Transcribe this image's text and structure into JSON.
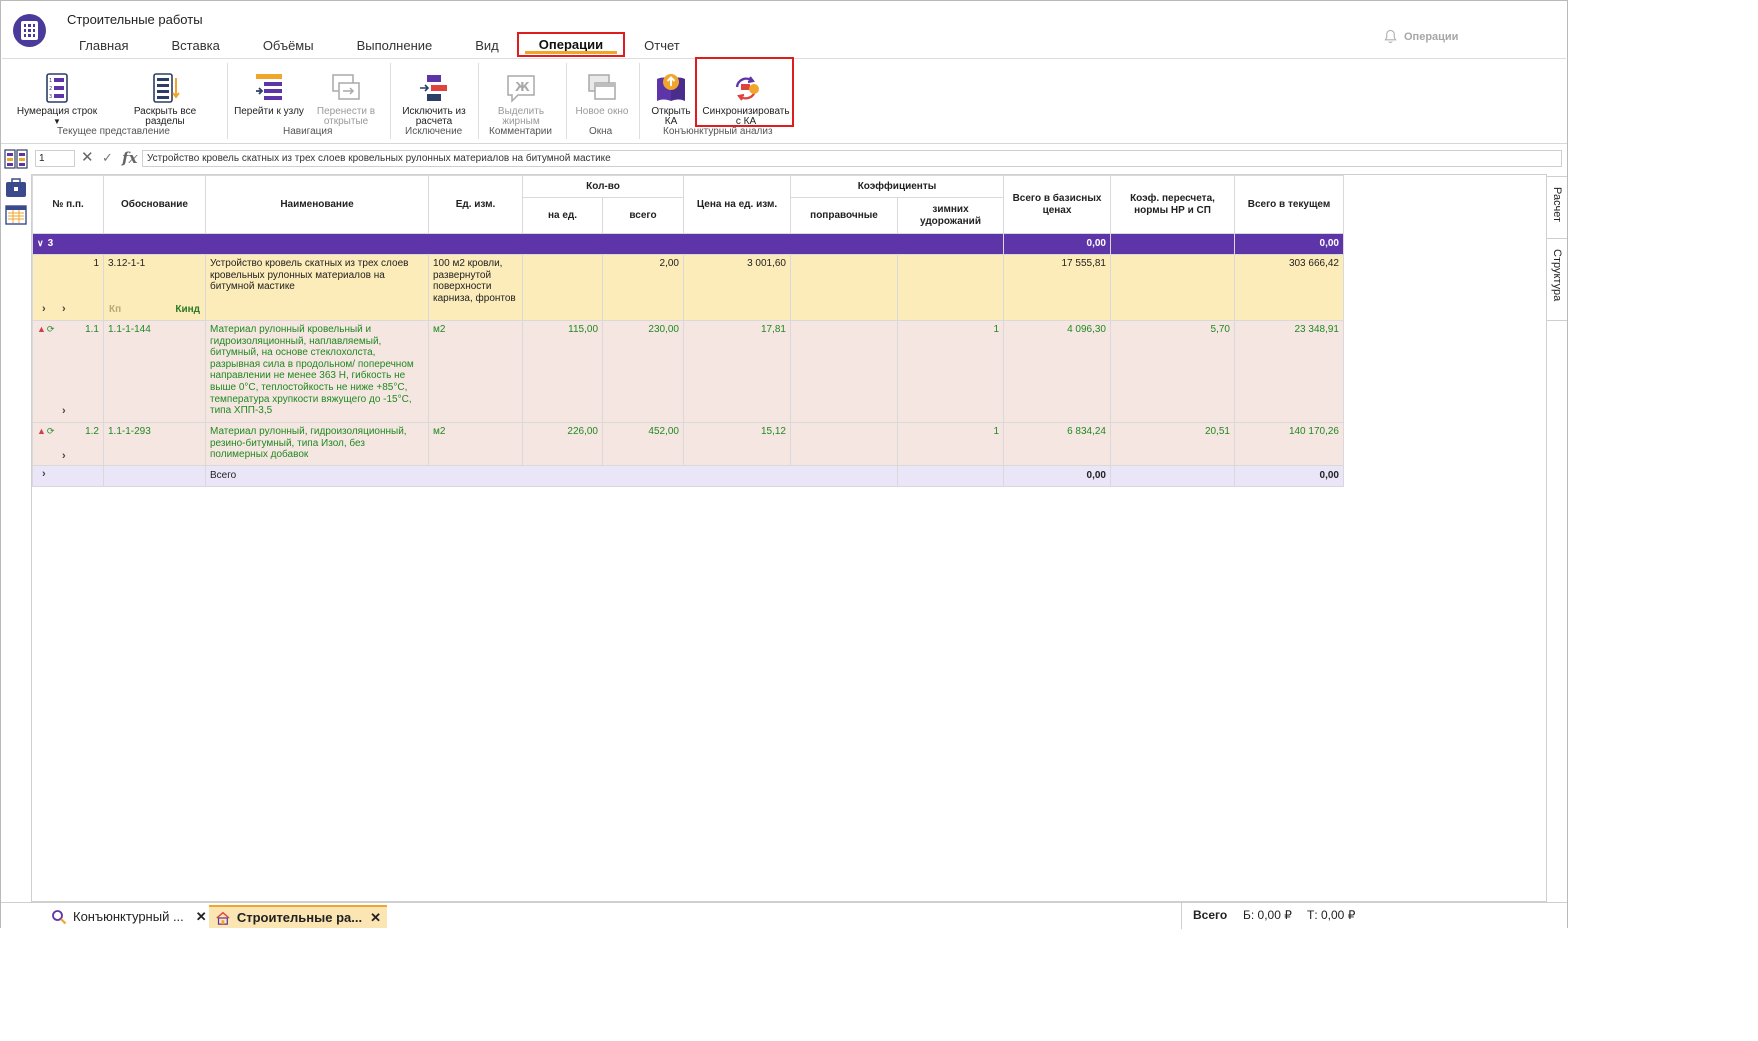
{
  "app": {
    "title": "Строительные работы",
    "notification_label": "Операции"
  },
  "menu": {
    "tabs": [
      {
        "label": "Главная"
      },
      {
        "label": "Вставка"
      },
      {
        "label": "Объёмы"
      },
      {
        "label": "Выполнение"
      },
      {
        "label": "Вид"
      },
      {
        "label": "Операции",
        "active": true
      },
      {
        "label": "Отчет"
      }
    ]
  },
  "ribbon": {
    "line_numbering": "Нумерация строк",
    "expand_sections": "Раскрыть все разделы",
    "group_view": "Текущее представление",
    "goto_node": "Перейти к узлу",
    "move_to_open": "Перенести в открытые",
    "group_nav": "Навигация",
    "exclude_calc": "Исключить из расчета",
    "group_exclusion": "Исключение",
    "bold": "Выделить жирным",
    "group_comments": "Комментарии",
    "new_window": "Новое окно",
    "group_windows": "Окна",
    "open_ka": "Открыть КА",
    "sync_ka": "Синхронизировать с КА",
    "group_market": "Конъюнктурный анализ",
    "accent_color": "#e01d1d"
  },
  "formula_bar": {
    "cell": "1",
    "value": "Устройство кровель скатных из трех слоев кровельных рулонных материалов на битумной мастике"
  },
  "table": {
    "headers": {
      "num": "№ п.п.",
      "basis": "Обоснование",
      "name": "Наименование",
      "unit": "Ед. изм.",
      "qty": "Кол-во",
      "qty_per_unit": "на ед.",
      "qty_total": "всего",
      "price": "Цена на ед. изм.",
      "coefs": "Коэффициенты",
      "coef_corr": "поправочные",
      "coef_winter": "зимних удорожаний",
      "total_base": "Всего в базисных ценах",
      "recalc": "Коэф. пересчета, нормы НР и СП",
      "total_current": "Всего в текущем"
    },
    "section": {
      "label": "3",
      "total_base": "0,00",
      "total_current": "0,00"
    },
    "main_row": {
      "num": "1",
      "basis": "3.12-1-1",
      "name": "Устройство кровель скатных из трех слоев кровельных рулонных материалов на битумной мастике",
      "unit": "100 м2 кровли, развернутой поверхности карниза, фронтов",
      "qty_total": "2,00",
      "price": "3 001,60",
      "total_base": "17 555,81",
      "total_current": "303 666,42",
      "kp_label": "Кп",
      "kind_label": "Кинд"
    },
    "resources": [
      {
        "num": "1.1",
        "basis": "1.1-1-144",
        "name": "Материал рулонный кровельный и гидроизоляционный, наплавляемый, битумный, на основе стеклохолста, разрывная сила в продольном/ поперечном направлении не менее 363 Н, гибкость не выше 0°С, теплостойкость не ниже +85°С, температура хрупкости вяжущего до -15°С, типа ХПП-3,5",
        "unit": "м2",
        "qty_per_unit": "115,00",
        "qty_total": "230,00",
        "price": "17,81",
        "coef_winter": "1",
        "total_base": "4 096,30",
        "recalc": "5,70",
        "total_current": "23 348,91"
      },
      {
        "num": "1.2",
        "basis": "1.1-1-293",
        "name": "Материал рулонный, гидроизоляционный, резино-битумный, типа Изол, без полимерных добавок",
        "unit": "м2",
        "qty_per_unit": "226,00",
        "qty_total": "452,00",
        "price": "15,12",
        "coef_winter": "1",
        "total_base": "6 834,24",
        "recalc": "20,51",
        "total_current": "140 170,26"
      }
    ],
    "total_row": {
      "label": "Всего",
      "total_base": "0,00",
      "total_current": "0,00"
    }
  },
  "side_tabs": [
    "Расчет",
    "Структура"
  ],
  "bottom": {
    "tabs": [
      {
        "label": "Конъюнктурный ..."
      },
      {
        "label": "Строительные ра...",
        "active": true
      }
    ],
    "total_label": "Всего",
    "total_b": "Б: 0,00 ₽",
    "total_t": "Т: 0,00 ₽"
  }
}
